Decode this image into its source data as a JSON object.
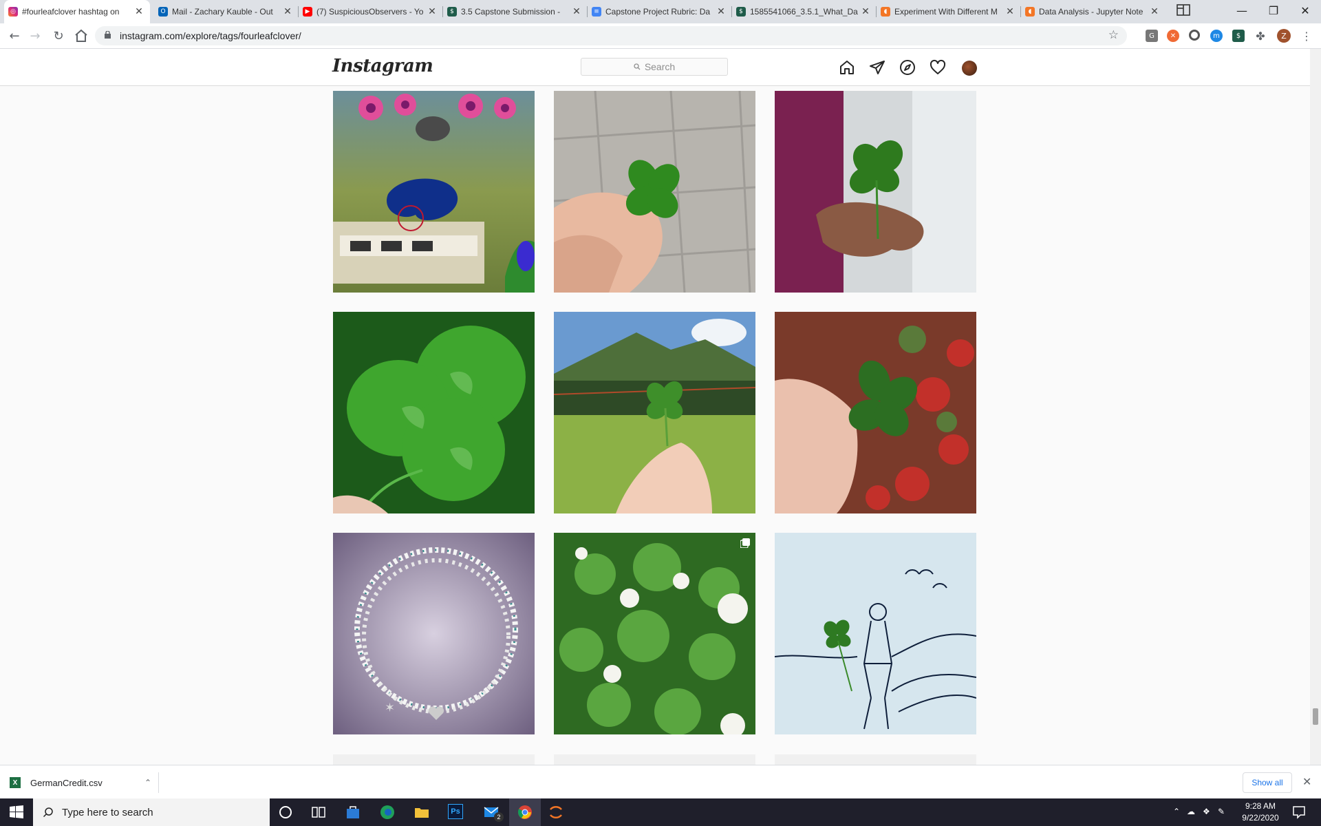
{
  "browser": {
    "tabs": [
      {
        "title": "#fourleafclover hashtag on",
        "icon": "instagram-icon",
        "color": "#d6249f",
        "active": true
      },
      {
        "title": "Mail - Zachary Kauble - Out",
        "icon": "outlook-icon",
        "color": "#0364b8"
      },
      {
        "title": "(7) SuspiciousObservers - Yo",
        "icon": "youtube-icon",
        "color": "#ff0000"
      },
      {
        "title": "3.5 Capstone Submission - ",
        "icon": "course-icon",
        "color": "#1f5c4a"
      },
      {
        "title": "Capstone Project Rubric: Da",
        "icon": "docs-icon",
        "color": "#4285f4"
      },
      {
        "title": "1585541066_3.5.1_What_Da",
        "icon": "course-icon",
        "color": "#1f5c4a"
      },
      {
        "title": "Experiment With Different M",
        "icon": "notebook-icon",
        "color": "#f37626"
      },
      {
        "title": "Data Analysis - Jupyter Note",
        "icon": "notebook-icon",
        "color": "#f37626"
      }
    ],
    "url": "instagram.com/explore/tags/fourleafclover/",
    "profile_initial": "Z"
  },
  "instagram": {
    "logo": "Instagram",
    "search_placeholder": "Search",
    "nav_icons": [
      "home-icon",
      "direct-icon",
      "explore-icon",
      "activity-heart-icon",
      "profile-avatar"
    ]
  },
  "download": {
    "filename": "GermanCredit.csv",
    "show_all": "Show all"
  },
  "taskbar": {
    "search_placeholder": "Type here to search",
    "mail_badge": "2",
    "time": "9:28 AM",
    "date": "9/22/2020"
  }
}
